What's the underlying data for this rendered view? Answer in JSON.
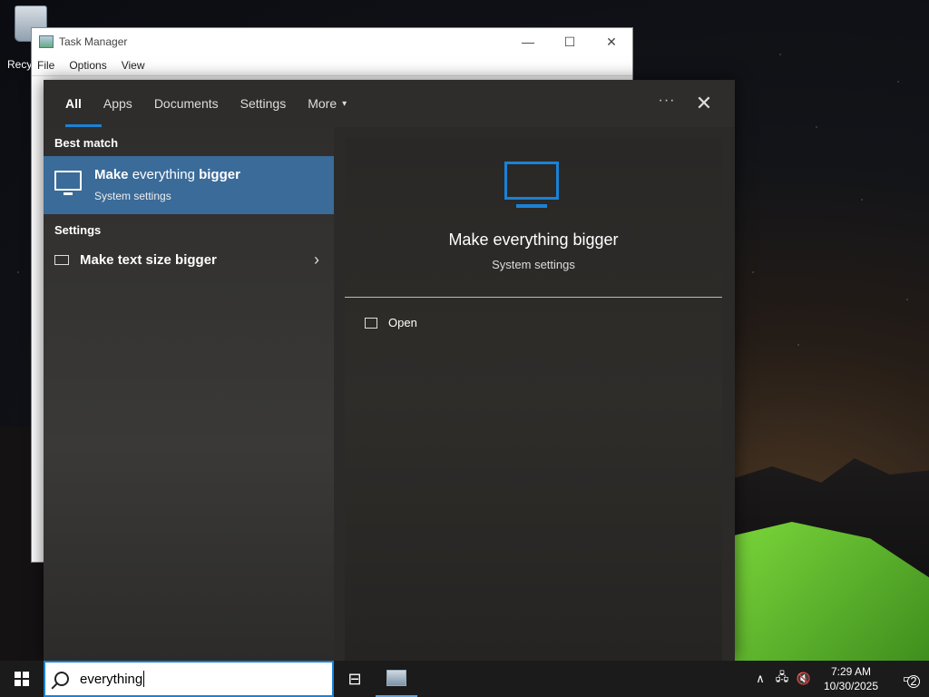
{
  "desktop": {
    "recycle_label": "Recy"
  },
  "task_manager": {
    "title": "Task Manager",
    "menu": [
      "File",
      "Options",
      "View"
    ],
    "controls": {
      "minimize": "—",
      "maximize": "☐",
      "close": "✕"
    }
  },
  "search_panel": {
    "tabs": [
      {
        "label": "All"
      },
      {
        "label": "Apps"
      },
      {
        "label": "Documents"
      },
      {
        "label": "Settings"
      },
      {
        "label": "More"
      }
    ],
    "more_caret": "▾",
    "overflow_icon": "···",
    "close_icon": "✕",
    "best_match_header": "Best match",
    "best_match": {
      "title_bold_1": "Make",
      "title_normal": " everything ",
      "title_bold_2": "bigger",
      "subtitle": "System settings"
    },
    "settings_header": "Settings",
    "settings_item": {
      "label": "Make text size bigger",
      "chevron": "›"
    },
    "preview": {
      "title": "Make everything bigger",
      "subtitle": "System settings",
      "open_label": "Open"
    }
  },
  "taskbar": {
    "search_value": "everything",
    "taskview_glyph": "⊟",
    "tray": {
      "chevron": "∧",
      "network": "🖧",
      "volume": "🔇"
    },
    "clock": {
      "time": "7:29 AM",
      "date": "10/30/2025"
    },
    "notification_count": "2"
  },
  "colors": {
    "accent": "#1a82d6",
    "selection": "#3a6b99",
    "panel": "#2b2a28"
  }
}
